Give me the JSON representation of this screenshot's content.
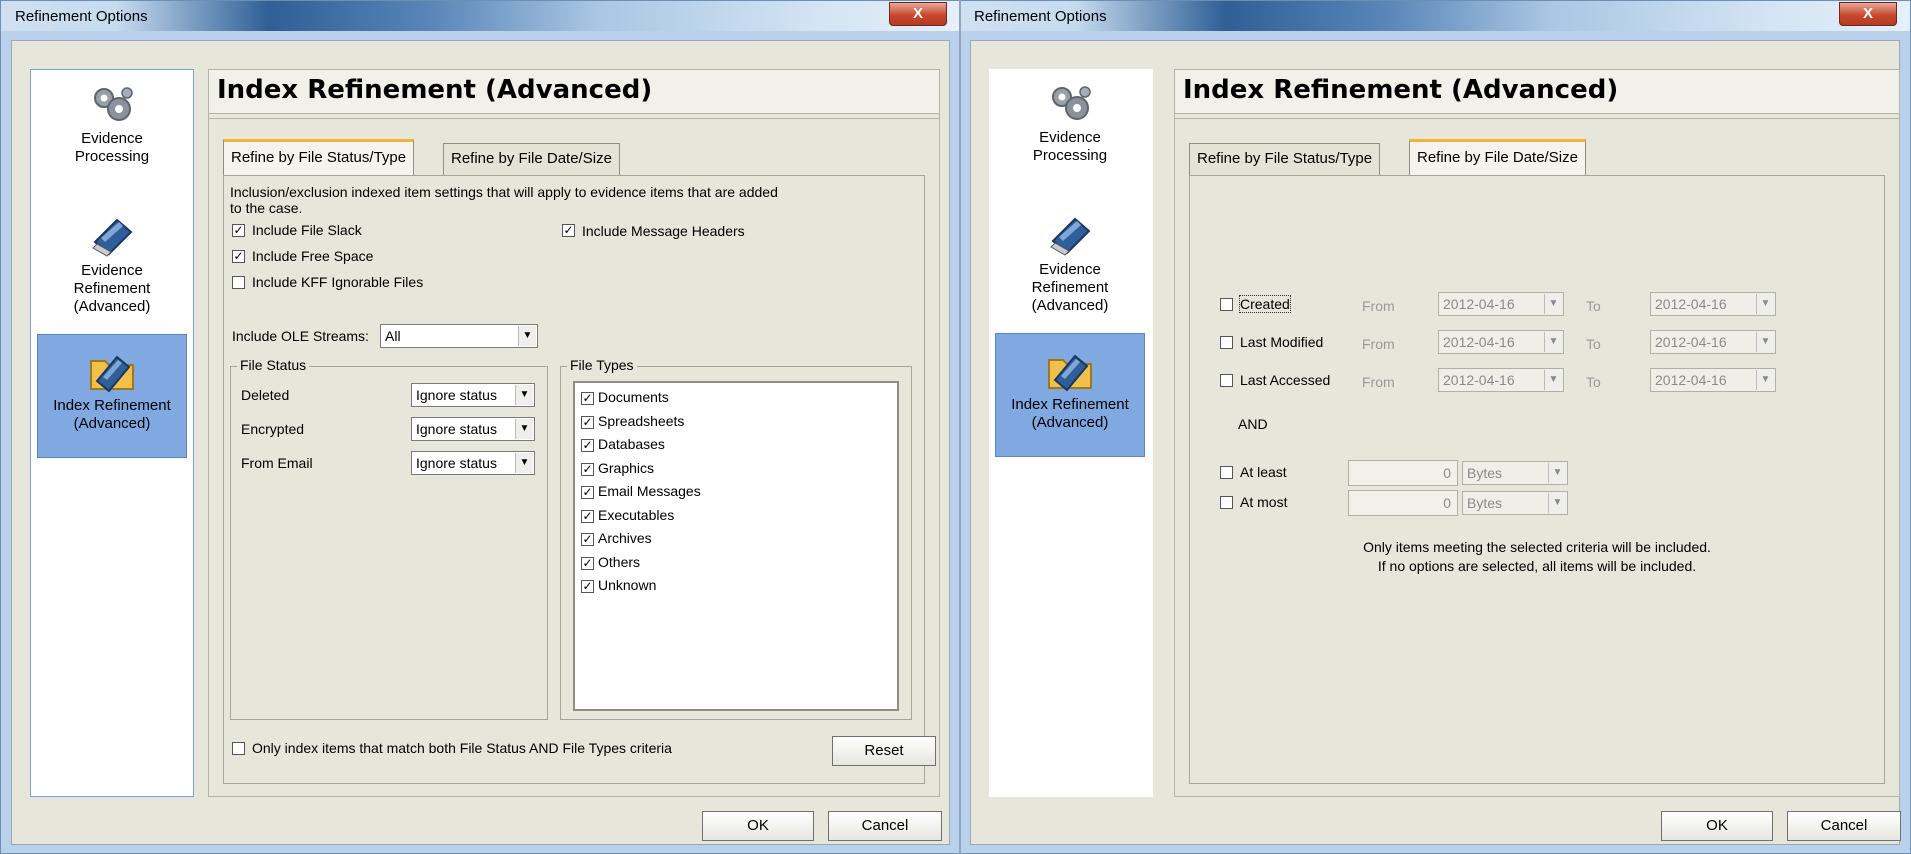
{
  "left": {
    "title": "Refinement Options",
    "close": "X",
    "nav": [
      {
        "label_line1": "Evidence",
        "label_line2": "Processing",
        "label_line3": ""
      },
      {
        "label_line1": "Evidence",
        "label_line2": "Refinement",
        "label_line3": "(Advanced)"
      },
      {
        "label_line1": "Index Refinement",
        "label_line2": "(Advanced)",
        "label_line3": ""
      }
    ],
    "header": "Index Refinement (Advanced)",
    "tabs": [
      "Refine by File Status/Type",
      "Refine by File Date/Size"
    ],
    "desc1": "Inclusion/exclusion indexed item settings that will apply to evidence items that are added",
    "desc2": "to the case.",
    "include_file_slack": "Include File Slack",
    "include_free_space": "Include Free Space",
    "include_kff": "Include KFF Ignorable Files",
    "include_message_headers": "Include Message Headers",
    "ole_label": "Include OLE Streams:",
    "ole_value": "All",
    "file_status_title": "File Status",
    "file_status": [
      {
        "label": "Deleted",
        "value": "Ignore status"
      },
      {
        "label": "Encrypted",
        "value": "Ignore status"
      },
      {
        "label": "From Email",
        "value": "Ignore status"
      }
    ],
    "file_types_title": "File Types",
    "file_types": [
      "Documents",
      "Spreadsheets",
      "Databases",
      "Graphics",
      "Email Messages",
      "Executables",
      "Archives",
      "Others",
      "Unknown"
    ],
    "match_both": "Only index items that match both File Status AND File Types criteria",
    "reset": "Reset",
    "ok": "OK",
    "cancel": "Cancel"
  },
  "right": {
    "title": "Refinement Options",
    "close": "X",
    "nav": [
      {
        "label_line1": "Evidence",
        "label_line2": "Processing",
        "label_line3": ""
      },
      {
        "label_line1": "Evidence",
        "label_line2": "Refinement",
        "label_line3": "(Advanced)"
      },
      {
        "label_line1": "Index Refinement",
        "label_line2": "(Advanced)",
        "label_line3": ""
      }
    ],
    "header": "Index Refinement (Advanced)",
    "tabs": [
      "Refine by File Status/Type",
      "Refine by File Date/Size"
    ],
    "date_rows": [
      {
        "label": "Created",
        "from_label": "From",
        "from_value": "2012-04-16",
        "to_label": "To",
        "to_value": "2012-04-16"
      },
      {
        "label": "Last Modified",
        "from_label": "From",
        "from_value": "2012-04-16",
        "to_label": "To",
        "to_value": "2012-04-16"
      },
      {
        "label": "Last Accessed",
        "from_label": "From",
        "from_value": "2012-04-16",
        "to_label": "To",
        "to_value": "2012-04-16"
      }
    ],
    "and_label": "AND",
    "size_rows": [
      {
        "label": "At least",
        "value": "0",
        "unit": "Bytes"
      },
      {
        "label": "At most",
        "value": "0",
        "unit": "Bytes"
      }
    ],
    "note1": "Only items meeting the selected criteria will be included.",
    "note2": "If no options are selected, all items will be included.",
    "ok": "OK",
    "cancel": "Cancel"
  }
}
